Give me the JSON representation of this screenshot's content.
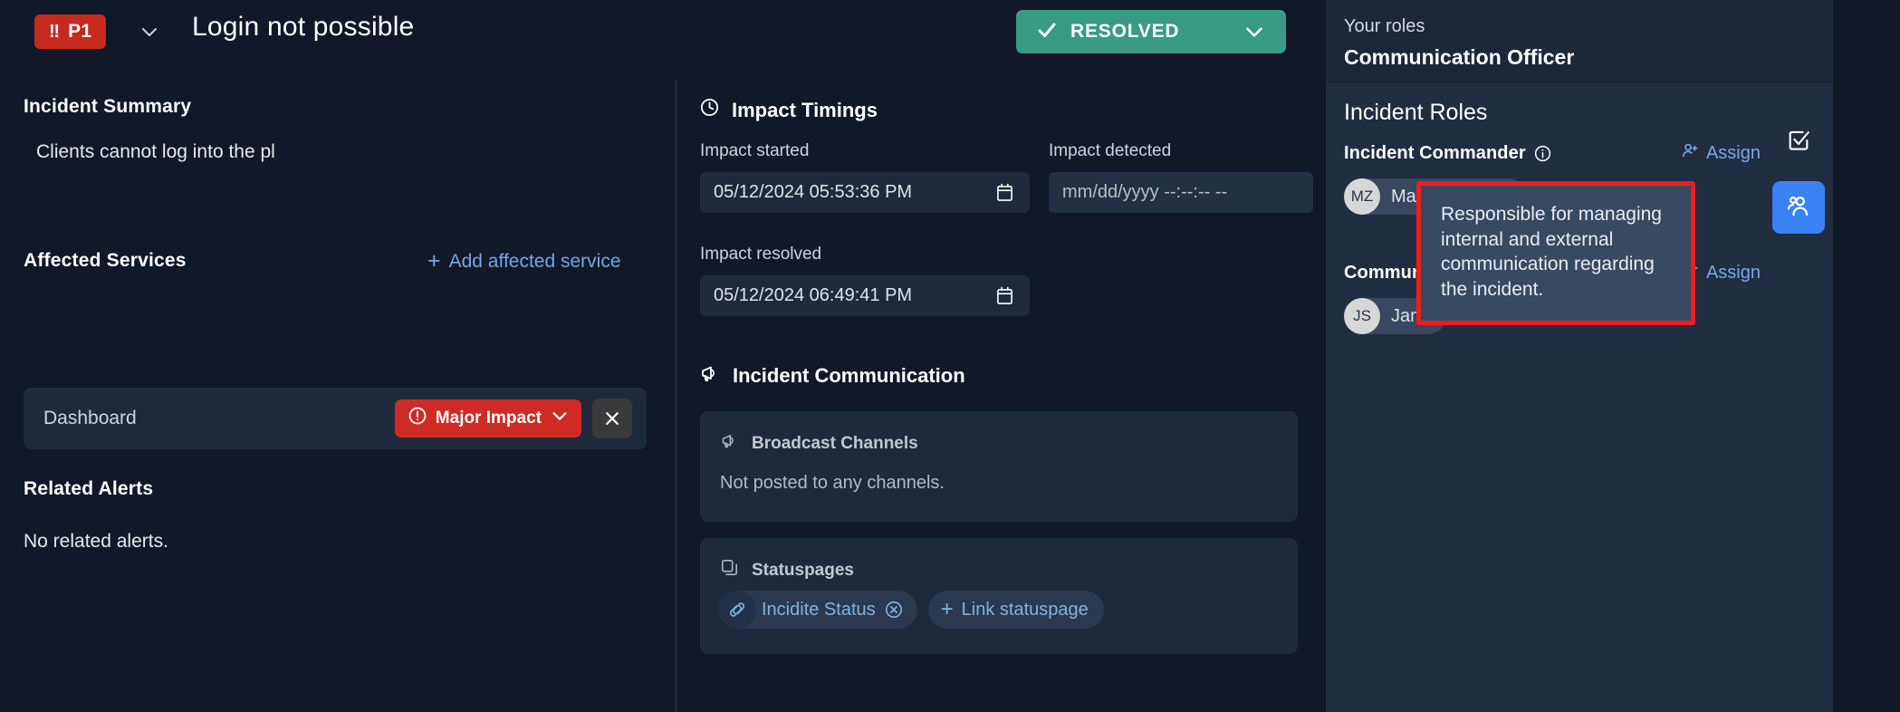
{
  "header": {
    "priority_badge": {
      "bangs": "‼",
      "label": "P1",
      "color": "#c62a1c",
      "icon": "double-exclamation-icon"
    },
    "priority_chevron_icon": "chevron-down-icon",
    "incident_title": "Login not possible",
    "status_button": {
      "label": "RESOLVED",
      "check_icon": "check-icon",
      "chevron_icon": "chevron-down-icon",
      "color": "#399b84"
    }
  },
  "left": {
    "summary": {
      "title": "Incident Summary",
      "text": "Clients cannot log into the pl"
    },
    "affected": {
      "title": "Affected Services",
      "add_label": "Add affected service",
      "add_icon": "plus-icon",
      "service": {
        "name": "Dashboard",
        "impact_label": "Major Impact",
        "impact_icon": "alert-circle-icon",
        "impact_chevron_icon": "chevron-down-icon",
        "impact_color": "#cf2b24",
        "remove_icon": "close-icon"
      }
    },
    "alerts": {
      "title": "Related Alerts",
      "empty": "No related alerts."
    }
  },
  "center": {
    "timings": {
      "title": "Impact Timings",
      "icon": "clock-icon",
      "started_label": "Impact started",
      "started_value": "05/12/2024 05:53:36 PM",
      "detected_label": "Impact detected",
      "detected_placeholder": "mm/dd/yyyy --:--:-- --",
      "resolved_label": "Impact resolved",
      "resolved_value": "05/12/2024 06:49:41 PM",
      "calendar_icon": "calendar-icon"
    },
    "communication": {
      "title": "Incident Communication",
      "icon": "megaphone-icon",
      "broadcast": {
        "title": "Broadcast Channels",
        "icon": "megaphone-icon",
        "body": "Not posted to any channels."
      },
      "statuspages": {
        "title": "Statuspages",
        "icon": "copy-icon",
        "chip": {
          "label": "Incidite Status",
          "link_icon": "link-icon",
          "remove_icon": "x-circle-icon"
        },
        "link_button": {
          "label": "Link statuspage",
          "icon": "plus-icon"
        }
      }
    }
  },
  "right": {
    "your_roles_label": "Your roles",
    "your_role_value": "Communication Officer",
    "roles_title": "Incident Roles",
    "assign_label": "Assign",
    "assign_icon": "person-plus-icon",
    "info_icon": "info-circle-icon",
    "roles": [
      {
        "name": "Incident Commander",
        "person_initials": "MZ",
        "person_name": "Marius Ziemke"
      },
      {
        "name": "Communication Officer",
        "person_initials": "JS",
        "person_name": "Jana"
      }
    ],
    "tooltip": {
      "text": "Responsible for managing internal and external communication regarding the incident.",
      "border_color": "#ef1d20"
    },
    "rail": [
      {
        "name": "tasks",
        "icon": "checkbox-checked-icon",
        "active": false
      },
      {
        "name": "roles",
        "icon": "people-icon",
        "active": true,
        "color": "#3b82f6"
      }
    ]
  }
}
